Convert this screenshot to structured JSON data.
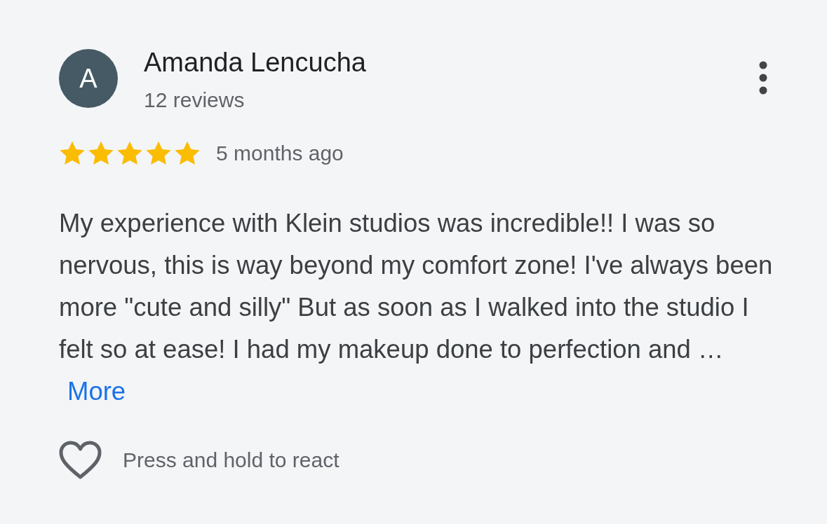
{
  "review": {
    "author": {
      "initial": "A",
      "name": "Amanda Lencucha",
      "reviews": "12 reviews"
    },
    "stars": 5,
    "time": "5 months ago",
    "text": "My experience with Klein studios was incredible!! I was so nervous, this is way beyond my comfort zone! I've always been more \"cute and silly\" But as soon as I walked into the studio I felt so at ease! I had my makeup done to perfection and …",
    "more_link": "More",
    "react_hint": "Press and hold to react"
  }
}
